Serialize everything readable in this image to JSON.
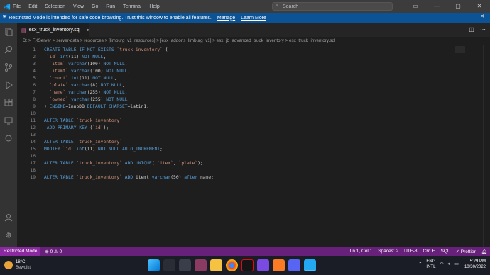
{
  "menu": [
    "File",
    "Edit",
    "Selection",
    "View",
    "Go",
    "Run",
    "Terminal",
    "Help"
  ],
  "search": {
    "placeholder": "Search"
  },
  "banner": {
    "text": "Restricted Mode is intended for safe code browsing. Trust this window to enable all features.",
    "manage": "Manage",
    "learn": "Learn More"
  },
  "tab": {
    "label": "esx_truck_inventory.sql"
  },
  "breadcrumb": "D: > FXServer > server-data > resources > [limburg_v1_resources] > [esx_addons_limburg_v1] > esx_jb_advanced_truck_inventory > esx_truck_inventory.sql",
  "code_lines": [
    {
      "n": "1",
      "t": "CREATE TABLE IF NOT EXISTS `truck_inventory` ("
    },
    {
      "n": "2",
      "t": " `id` int(11) NOT NULL,"
    },
    {
      "n": "3",
      "t": "  `item` varchar(100) NOT NULL,"
    },
    {
      "n": "4",
      "t": "  `itemt` varchar(100) NOT NULL,"
    },
    {
      "n": "5",
      "t": "  `count` int(11) NOT NULL,"
    },
    {
      "n": "6",
      "t": "  `plate` varchar(8) NOT NULL,"
    },
    {
      "n": "7",
      "t": "  `name` varchar(255) NOT NULL,"
    },
    {
      "n": "8",
      "t": "  `owned` varchar(255) NOT NULL"
    },
    {
      "n": "9",
      "t": ") ENGINE=InnoDB DEFAULT CHARSET=latin1;"
    },
    {
      "n": "10",
      "t": ""
    },
    {
      "n": "11",
      "t": "ALTER TABLE `truck_inventory`"
    },
    {
      "n": "12",
      "t": " ADD PRIMARY KEY (`id`);"
    },
    {
      "n": "13",
      "t": ""
    },
    {
      "n": "14",
      "t": "ALTER TABLE `truck_inventory`"
    },
    {
      "n": "15",
      "t": "MODIFY `id` int(11) NOT NULL AUTO_INCREMENT;"
    },
    {
      "n": "16",
      "t": ""
    },
    {
      "n": "17",
      "t": "ALTER TABLE `truck_inventory` ADD UNIQUE( `item`, `plate`);"
    },
    {
      "n": "18",
      "t": ""
    },
    {
      "n": "19",
      "t": "ALTER TABLE `truck_inventory` ADD itemt varchar(50) after name;"
    }
  ],
  "status": {
    "restricted": "Restricted Mode",
    "problems": "⊗ 0 ⚠ 0",
    "position": "Ln 1, Col 1",
    "spaces": "Spaces: 2",
    "encoding": "UTF-8",
    "eol": "CRLF",
    "language": "SQL",
    "prettier": "✓ Prettier"
  },
  "taskbar": {
    "temp": "18°C",
    "weather": "Bewolkt",
    "lang1": "ENG",
    "lang2": "INTL",
    "time": "5:29 PM",
    "date": "10/30/2022"
  },
  "colors": {
    "accent": "#0b5394",
    "status": "#68217a",
    "keyword": "#569cd6",
    "string": "#ce9178"
  }
}
